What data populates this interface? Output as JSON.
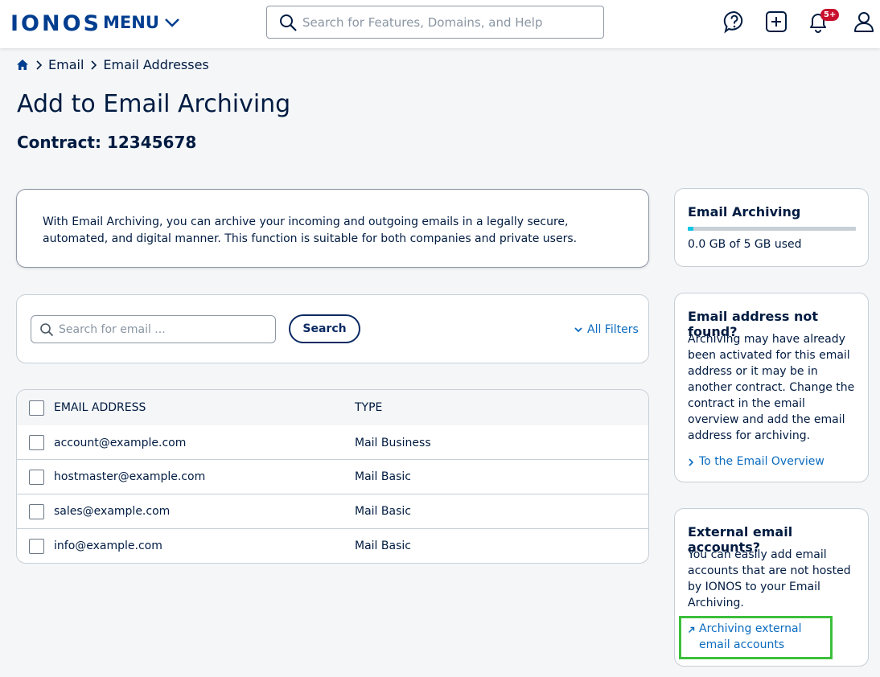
{
  "header": {
    "logo": "IONOS",
    "menu_label": "MENU",
    "search_placeholder": "Search for Features, Domains, and Help",
    "notification_badge": "5+",
    "icons": [
      "help-chat-icon",
      "add-icon",
      "bell-icon",
      "user-icon"
    ]
  },
  "breadcrumb": {
    "items": [
      "Email",
      "Email Addresses"
    ]
  },
  "page": {
    "title": "Add to Email Archiving",
    "contract": "Contract: 12345678"
  },
  "info": {
    "text": "With Email Archiving, you can archive your incoming and outgoing emails in a legally secure, automated, and digital manner. This function is suitable for both companies and private users."
  },
  "filters": {
    "search_placeholder": "Search for email ...",
    "search_button": "Search",
    "all_filters": "All Filters"
  },
  "table": {
    "columns": [
      "EMAIL ADDRESS",
      "TYPE"
    ],
    "rows": [
      {
        "email": "account@example.com",
        "type": "Mail Business"
      },
      {
        "email": "hostmaster@example.com",
        "type": "Mail Basic"
      },
      {
        "email": "sales@example.com",
        "type": "Mail Basic"
      },
      {
        "email": "info@example.com",
        "type": "Mail Basic"
      }
    ]
  },
  "sidebar": {
    "archiving": {
      "title": "Email Archiving",
      "usage": "0.0 GB of 5 GB used",
      "used_fraction": 0.035
    },
    "not_found": {
      "title": "Email address not found?",
      "text": "Archiving may have already been activated for this email address or it may be in another contract. Change the contract in the email overview and add the email address for archiving.",
      "link": "To the Email Overview"
    },
    "external": {
      "title": "External email accounts?",
      "text": "You can easily add email accounts that are not hosted by IONOS to your Email Archiving.",
      "link": "Archiving external email accounts"
    }
  },
  "colors": {
    "brand": "#003d8f",
    "text": "#001b41",
    "link": "#0b6bbf",
    "progress_fill": "#11c7e6",
    "badge": "#c8102e",
    "highlight": "#3cbf3c"
  }
}
